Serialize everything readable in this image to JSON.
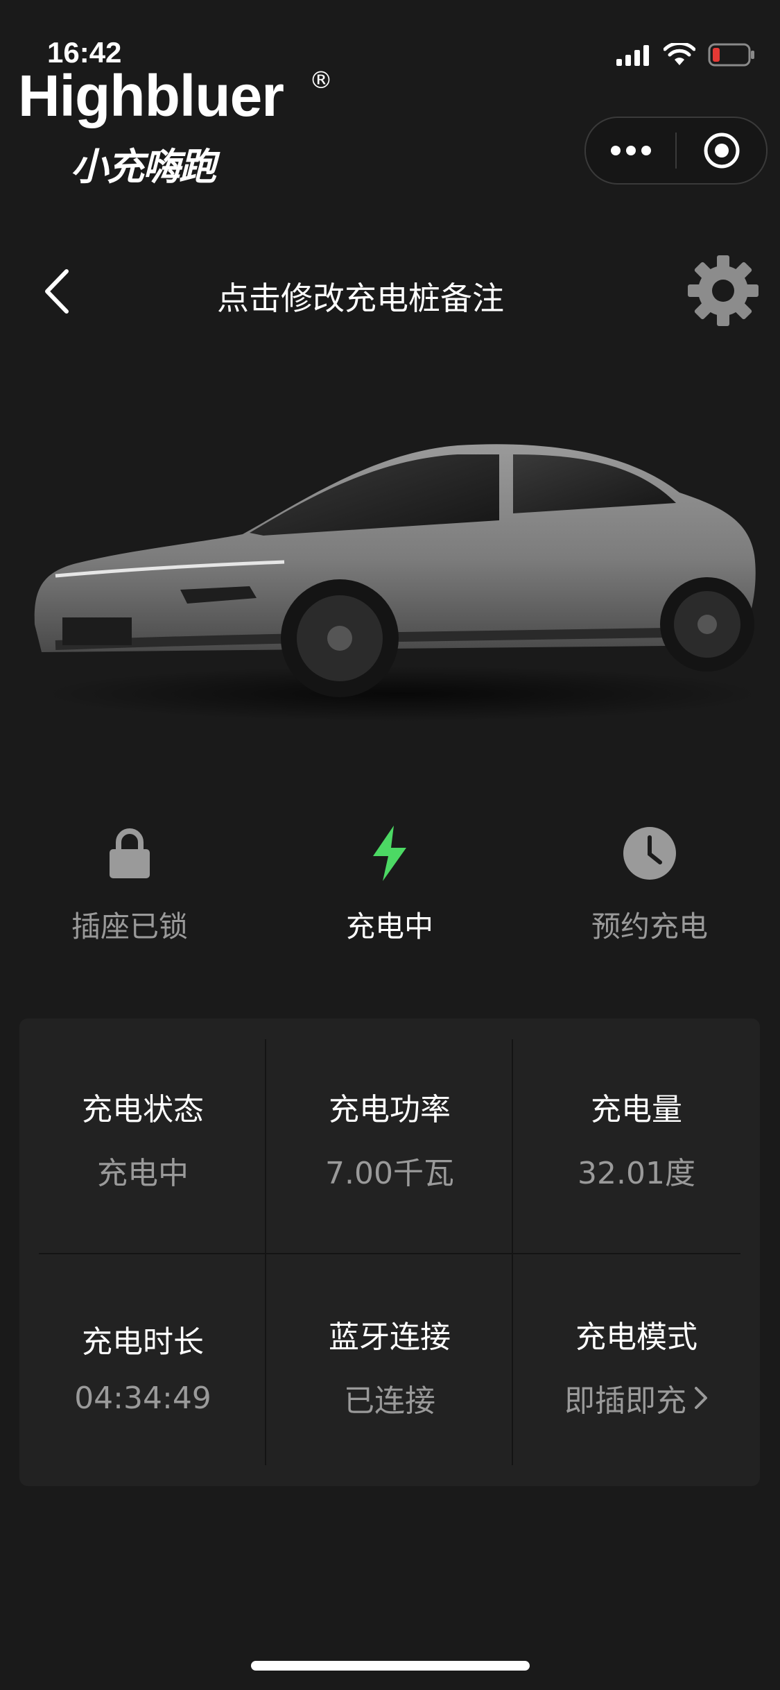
{
  "status_bar": {
    "time": "16:42",
    "icons": [
      "signal-icon",
      "wifi-icon",
      "battery-low-icon"
    ],
    "battery_color": "#e53935"
  },
  "logo": {
    "brand": "Highbluer",
    "registered_mark": "®",
    "slogan": "小充嗨跑"
  },
  "mini_program_capsule": {
    "icons": [
      "more-dots-icon",
      "close-target-icon"
    ]
  },
  "nav": {
    "back_icon": "chevron-left-icon",
    "title": "点击修改充电桩备注",
    "settings_icon": "gear-icon"
  },
  "actions": [
    {
      "label": "插座已锁",
      "icon": "lock-icon",
      "active": false
    },
    {
      "label": "充电中",
      "icon": "lightning-icon",
      "active": true
    },
    {
      "label": "预约充电",
      "icon": "clock-icon",
      "active": false
    }
  ],
  "colors": {
    "background": "#1a1a1a",
    "panel": "#222222",
    "accent_green": "#4cd964",
    "muted_text": "#9a9a9a",
    "icon_gray": "#9a9a9a"
  },
  "stats": [
    {
      "title": "充电状态",
      "value": "充电中"
    },
    {
      "title": "充电功率",
      "value": "7.00千瓦"
    },
    {
      "title": "充电量",
      "value": "32.01度"
    },
    {
      "title": "充电时长",
      "value": "04:34:49"
    },
    {
      "title": "蓝牙连接",
      "value": "已连接"
    },
    {
      "title": "充电模式",
      "value": "即插即充",
      "has_chevron": true
    }
  ]
}
